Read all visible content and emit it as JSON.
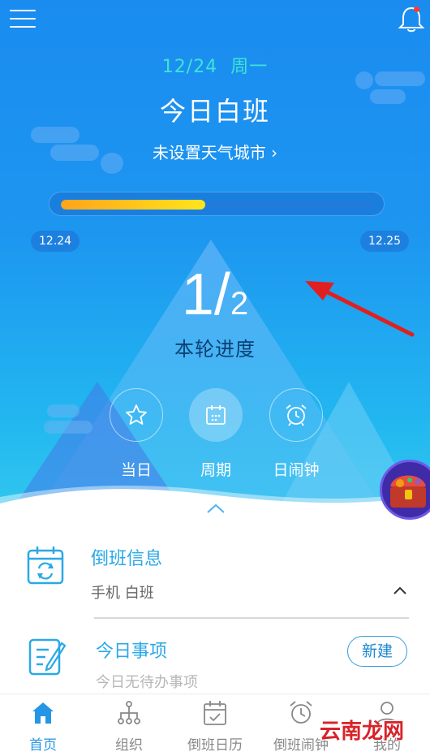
{
  "header": {
    "date": "12/24",
    "weekday": "周一",
    "shift_title": "今日白班",
    "weather_link": "未设置天气城市 ›"
  },
  "progress": {
    "fraction": 0.46,
    "start_date": "12.24",
    "end_date": "12.25"
  },
  "cycle": {
    "current": "1",
    "total": "2",
    "label": "本轮进度"
  },
  "view_tabs": [
    {
      "label": "当日",
      "icon": "star-icon"
    },
    {
      "label": "周期",
      "icon": "calendar-icon",
      "active": true
    },
    {
      "label": "日闹钟",
      "icon": "alarm-clock-icon"
    }
  ],
  "shift_info": {
    "title": "倒班信息",
    "detail": "手机  白班"
  },
  "todo": {
    "title": "今日事项",
    "empty_text": "今日无待办事项",
    "new_label": "新建"
  },
  "bottom_nav": [
    {
      "label": "首页",
      "icon": "home-icon",
      "active": true
    },
    {
      "label": "组织",
      "icon": "org-chart-icon"
    },
    {
      "label": "倒班日历",
      "icon": "calendar-check-icon"
    },
    {
      "label": "倒班闹钟",
      "icon": "alarm-clock-icon"
    },
    {
      "label": "我的",
      "icon": "user-icon"
    }
  ],
  "watermark": "云南龙网",
  "colors": {
    "accent": "#2596e6",
    "date_text": "#3ee3d6",
    "progress_start": "#ffa41c",
    "progress_end": "#ffe51c",
    "annotation_arrow": "#e02020"
  }
}
